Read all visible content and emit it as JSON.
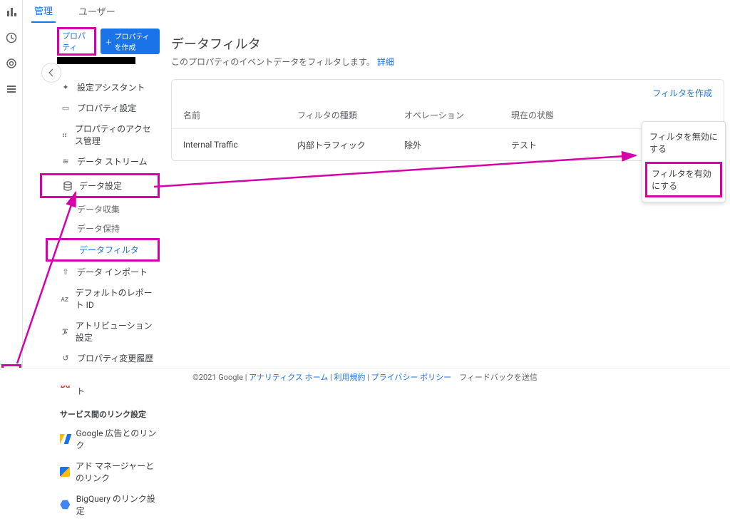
{
  "tabs": {
    "admin": "管理",
    "user": "ユーザー"
  },
  "sidebar": {
    "property_chip": "プロパティ",
    "create_property": "プロパティを作成",
    "items": {
      "setup_assistant": "設定アシスタント",
      "property_settings": "プロパティ設定",
      "access_mgmt": "プロパティのアクセス管理",
      "data_streams": "データ ストリーム",
      "data_settings": "データ設定",
      "data_collection": "データ収集",
      "data_retention": "データ保持",
      "data_filters": "データフィルタ",
      "data_import": "データ インポート",
      "default_report_id": "デフォルトのレポート ID",
      "attribution": "アトリビューション設定",
      "change_history": "プロパティ変更履歴",
      "delete_requests": "データ削除リクエスト",
      "link_section": "サービス間のリンク設定",
      "google_ads_link": "Google 広告とのリンク",
      "ad_manager_link": "アド マネージャーとのリンク",
      "bigquery_link": "BigQuery のリンク設定"
    }
  },
  "main": {
    "title": "データフィルタ",
    "subtitle_a": "このプロパティのイベントデータをフィルタします。",
    "subtitle_link": "詳細",
    "create_filter": "フィルタを作成",
    "columns": {
      "name": "名前",
      "type": "フィルタの種類",
      "operation": "オペレーション",
      "state": "現在の状態"
    },
    "row": {
      "name": "Internal Traffic",
      "type": "内部トラフィック",
      "operation": "除外",
      "state": "テスト"
    }
  },
  "menu": {
    "disable": "フィルタを無効にする",
    "enable": "フィルタを有効にする"
  },
  "footer": {
    "copyright": "©2021 Google",
    "home": "アナリティクス ホーム",
    "terms": "利用規約",
    "privacy": "プライバシー ポリシー",
    "feedback": "フィードバックを送信"
  }
}
